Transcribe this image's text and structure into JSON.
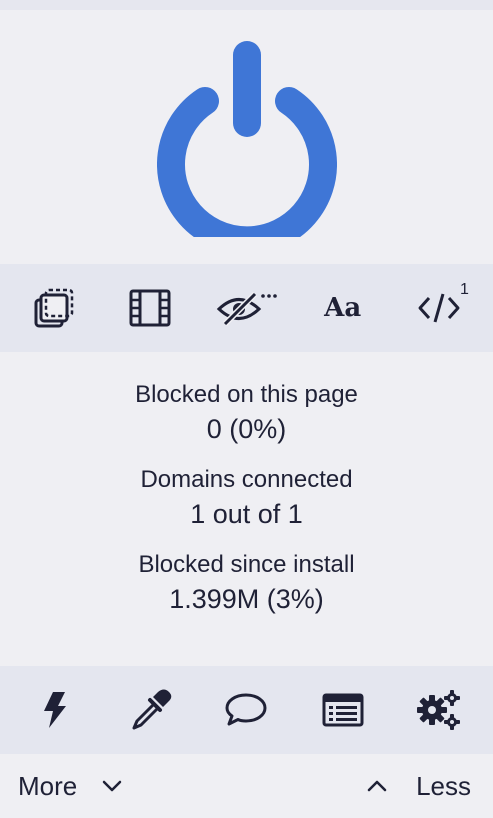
{
  "colors": {
    "accent": "#3f76d6",
    "background": "#efeff3",
    "toolbar": "#e4e6ef",
    "text": "#1f2136"
  },
  "power": {
    "icon": "power-icon",
    "state": "on"
  },
  "top_tools": [
    {
      "icon": "popup-block-icon"
    },
    {
      "icon": "media-block-icon"
    },
    {
      "icon": "cosmetic-filter-icon"
    },
    {
      "icon": "remote-fonts-icon",
      "label": "Aa"
    },
    {
      "icon": "javascript-icon",
      "badge": "1"
    }
  ],
  "stats": {
    "blocked_page": {
      "label": "Blocked on this page",
      "value": "0 (0%)"
    },
    "domains": {
      "label": "Domains connected",
      "value": "1 out of 1"
    },
    "blocked_install": {
      "label": "Blocked since install",
      "value": "1.399M (3%)"
    }
  },
  "bottom_tools": [
    {
      "icon": "lightning-icon"
    },
    {
      "icon": "eyedropper-icon"
    },
    {
      "icon": "speech-bubble-icon"
    },
    {
      "icon": "logger-icon"
    },
    {
      "icon": "settings-gears-icon"
    }
  ],
  "footer": {
    "more_label": "More",
    "less_label": "Less"
  }
}
